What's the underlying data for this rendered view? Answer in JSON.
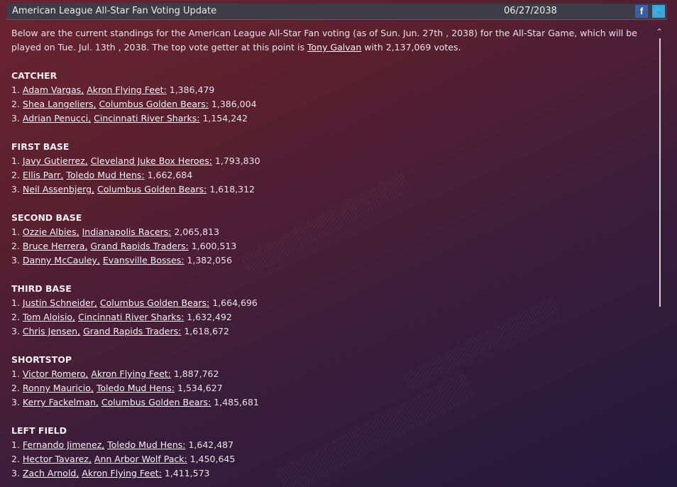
{
  "header": {
    "title": "American League All-Star Fan Voting Update",
    "date": "06/27/2038",
    "facebook_icon": "f",
    "twitter_icon": "🐦"
  },
  "intro": {
    "pre": "Below are the current standings for the American League All-Star Fan voting (as of Sun. Jun. 27th , 2038) for the All-Star Game, which will be played on Tue. Jul. 13th , 2038. The top vote getter at this point is ",
    "leader": "Tony Galvan",
    "post": " with 2,137,069 votes."
  },
  "scroll_up_icon": "⌃",
  "positions": [
    {
      "name": "CATCHER",
      "entries": [
        {
          "rank": "1. ",
          "player": "Adam Vargas",
          "team": "Akron  Flying Feet:",
          "votes": " 1,386,479"
        },
        {
          "rank": "2. ",
          "player": "Shea Langeliers",
          "team": "Columbus Golden Bears:",
          "votes": " 1,386,004"
        },
        {
          "rank": "3. ",
          "player": "Adrian Penucci",
          "team": "Cincinnati River Sharks:",
          "votes": " 1,154,242"
        }
      ]
    },
    {
      "name": "FIRST BASE",
      "entries": [
        {
          "rank": "1. ",
          "player": "Javy Gutierrez",
          "team": "Cleveland Juke Box Heroes:",
          "votes": " 1,793,830"
        },
        {
          "rank": "2. ",
          "player": "Ellis Parr",
          "team": "Toledo  Mud Hens:",
          "votes": " 1,662,684"
        },
        {
          "rank": "3. ",
          "player": "Neil Assenbjerg",
          "team": "Columbus Golden Bears:",
          "votes": " 1,618,312"
        }
      ]
    },
    {
      "name": "SECOND BASE",
      "entries": [
        {
          "rank": "1. ",
          "player": "Ozzie Albies",
          "team": "Indianapolis Racers:",
          "votes": " 2,065,813"
        },
        {
          "rank": "2. ",
          "player": "Bruce Herrera",
          "team": "Grand Rapids Traders:",
          "votes": " 1,600,513"
        },
        {
          "rank": "3. ",
          "player": "Danny McCauley",
          "team": "Evansville Bosses:",
          "votes": " 1,382,056"
        }
      ]
    },
    {
      "name": "THIRD BASE",
      "entries": [
        {
          "rank": "1. ",
          "player": "Justin Schneider",
          "team": "Columbus Golden Bears:",
          "votes": " 1,664,696"
        },
        {
          "rank": "2. ",
          "player": "Tom Aloisio",
          "team": "Cincinnati River Sharks:",
          "votes": " 1,632,492"
        },
        {
          "rank": "3. ",
          "player": "Chris Jensen",
          "team": "Grand Rapids Traders:",
          "votes": " 1,618,672"
        }
      ]
    },
    {
      "name": "SHORTSTOP",
      "entries": [
        {
          "rank": "1. ",
          "player": "Victor Romero",
          "team": "Akron  Flying Feet:",
          "votes": " 1,887,762"
        },
        {
          "rank": "2. ",
          "player": "Ronny Mauricio",
          "team": "Toledo  Mud Hens:",
          "votes": " 1,534,627"
        },
        {
          "rank": "3. ",
          "player": "Kerry Fackelman",
          "team": "Columbus Golden Bears:",
          "votes": " 1,485,681"
        }
      ]
    },
    {
      "name": "LEFT FIELD",
      "entries": [
        {
          "rank": "1. ",
          "player": "Fernando Jimenez",
          "team": "Toledo  Mud Hens:",
          "votes": " 1,642,487"
        },
        {
          "rank": "2. ",
          "player": "Hector Tavarez",
          "team": "Ann Arbor Wolf Pack:",
          "votes": " 1,450,645"
        },
        {
          "rank": "3. ",
          "player": "Zach Arnold",
          "team": "Akron  Flying Feet:",
          "votes": " 1,411,573"
        }
      ]
    }
  ]
}
